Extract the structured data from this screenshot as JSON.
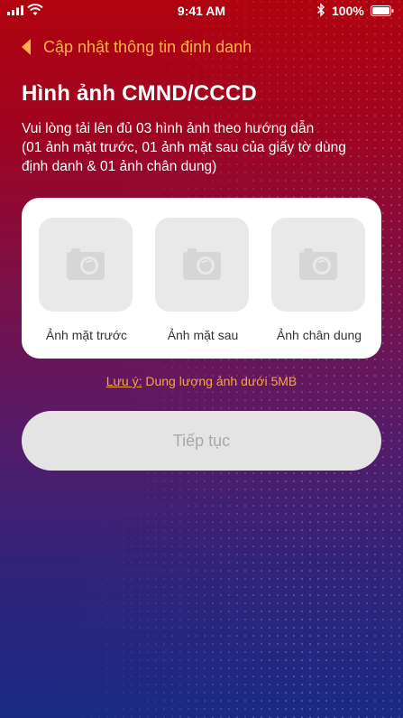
{
  "status_bar": {
    "time": "9:41 AM",
    "battery": "100%"
  },
  "nav": {
    "back_title": "Cập nhật thông tin định danh"
  },
  "page": {
    "title": "Hình ảnh CMND/CCCD",
    "description_lines": [
      "Vui lòng tải lên đủ 03 hình ảnh theo hướng dẫn",
      "(01 ảnh mặt trước, 01 ảnh mặt sau của giấy tờ dùng",
      "định danh & 01 ảnh chân dung)"
    ]
  },
  "uploads": [
    {
      "label": "Ảnh mặt trước",
      "icon": "camera-icon"
    },
    {
      "label": "Ảnh mặt sau",
      "icon": "camera-icon"
    },
    {
      "label": "Ảnh chân dung",
      "icon": "camera-icon"
    }
  ],
  "note": {
    "label": "Lưu ý:",
    "text": "Dung lượng ảnh dưới 5MB"
  },
  "continue_button": "Tiếp tục",
  "colors": {
    "accent": "#ffb04a",
    "background_top": "#b0030f",
    "background_bottom": "#1a2a84",
    "card": "#ffffff",
    "placeholder": "#e9e9e9"
  }
}
